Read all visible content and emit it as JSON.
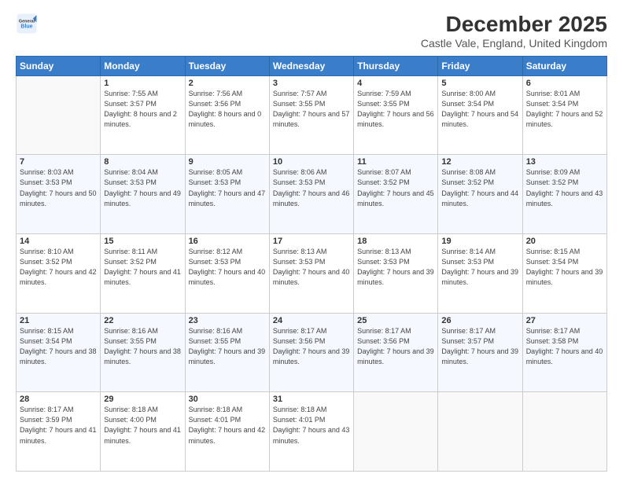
{
  "header": {
    "logo_general": "General",
    "logo_blue": "Blue",
    "title": "December 2025",
    "subtitle": "Castle Vale, England, United Kingdom"
  },
  "days_of_week": [
    "Sunday",
    "Monday",
    "Tuesday",
    "Wednesday",
    "Thursday",
    "Friday",
    "Saturday"
  ],
  "weeks": [
    [
      {
        "day": "",
        "empty": true
      },
      {
        "day": "1",
        "sunrise": "Sunrise: 7:55 AM",
        "sunset": "Sunset: 3:57 PM",
        "daylight": "Daylight: 8 hours and 2 minutes."
      },
      {
        "day": "2",
        "sunrise": "Sunrise: 7:56 AM",
        "sunset": "Sunset: 3:56 PM",
        "daylight": "Daylight: 8 hours and 0 minutes."
      },
      {
        "day": "3",
        "sunrise": "Sunrise: 7:57 AM",
        "sunset": "Sunset: 3:55 PM",
        "daylight": "Daylight: 7 hours and 57 minutes."
      },
      {
        "day": "4",
        "sunrise": "Sunrise: 7:59 AM",
        "sunset": "Sunset: 3:55 PM",
        "daylight": "Daylight: 7 hours and 56 minutes."
      },
      {
        "day": "5",
        "sunrise": "Sunrise: 8:00 AM",
        "sunset": "Sunset: 3:54 PM",
        "daylight": "Daylight: 7 hours and 54 minutes."
      },
      {
        "day": "6",
        "sunrise": "Sunrise: 8:01 AM",
        "sunset": "Sunset: 3:54 PM",
        "daylight": "Daylight: 7 hours and 52 minutes."
      }
    ],
    [
      {
        "day": "7",
        "sunrise": "Sunrise: 8:03 AM",
        "sunset": "Sunset: 3:53 PM",
        "daylight": "Daylight: 7 hours and 50 minutes."
      },
      {
        "day": "8",
        "sunrise": "Sunrise: 8:04 AM",
        "sunset": "Sunset: 3:53 PM",
        "daylight": "Daylight: 7 hours and 49 minutes."
      },
      {
        "day": "9",
        "sunrise": "Sunrise: 8:05 AM",
        "sunset": "Sunset: 3:53 PM",
        "daylight": "Daylight: 7 hours and 47 minutes."
      },
      {
        "day": "10",
        "sunrise": "Sunrise: 8:06 AM",
        "sunset": "Sunset: 3:53 PM",
        "daylight": "Daylight: 7 hours and 46 minutes."
      },
      {
        "day": "11",
        "sunrise": "Sunrise: 8:07 AM",
        "sunset": "Sunset: 3:52 PM",
        "daylight": "Daylight: 7 hours and 45 minutes."
      },
      {
        "day": "12",
        "sunrise": "Sunrise: 8:08 AM",
        "sunset": "Sunset: 3:52 PM",
        "daylight": "Daylight: 7 hours and 44 minutes."
      },
      {
        "day": "13",
        "sunrise": "Sunrise: 8:09 AM",
        "sunset": "Sunset: 3:52 PM",
        "daylight": "Daylight: 7 hours and 43 minutes."
      }
    ],
    [
      {
        "day": "14",
        "sunrise": "Sunrise: 8:10 AM",
        "sunset": "Sunset: 3:52 PM",
        "daylight": "Daylight: 7 hours and 42 minutes."
      },
      {
        "day": "15",
        "sunrise": "Sunrise: 8:11 AM",
        "sunset": "Sunset: 3:52 PM",
        "daylight": "Daylight: 7 hours and 41 minutes."
      },
      {
        "day": "16",
        "sunrise": "Sunrise: 8:12 AM",
        "sunset": "Sunset: 3:53 PM",
        "daylight": "Daylight: 7 hours and 40 minutes."
      },
      {
        "day": "17",
        "sunrise": "Sunrise: 8:13 AM",
        "sunset": "Sunset: 3:53 PM",
        "daylight": "Daylight: 7 hours and 40 minutes."
      },
      {
        "day": "18",
        "sunrise": "Sunrise: 8:13 AM",
        "sunset": "Sunset: 3:53 PM",
        "daylight": "Daylight: 7 hours and 39 minutes."
      },
      {
        "day": "19",
        "sunrise": "Sunrise: 8:14 AM",
        "sunset": "Sunset: 3:53 PM",
        "daylight": "Daylight: 7 hours and 39 minutes."
      },
      {
        "day": "20",
        "sunrise": "Sunrise: 8:15 AM",
        "sunset": "Sunset: 3:54 PM",
        "daylight": "Daylight: 7 hours and 39 minutes."
      }
    ],
    [
      {
        "day": "21",
        "sunrise": "Sunrise: 8:15 AM",
        "sunset": "Sunset: 3:54 PM",
        "daylight": "Daylight: 7 hours and 38 minutes."
      },
      {
        "day": "22",
        "sunrise": "Sunrise: 8:16 AM",
        "sunset": "Sunset: 3:55 PM",
        "daylight": "Daylight: 7 hours and 38 minutes."
      },
      {
        "day": "23",
        "sunrise": "Sunrise: 8:16 AM",
        "sunset": "Sunset: 3:55 PM",
        "daylight": "Daylight: 7 hours and 39 minutes."
      },
      {
        "day": "24",
        "sunrise": "Sunrise: 8:17 AM",
        "sunset": "Sunset: 3:56 PM",
        "daylight": "Daylight: 7 hours and 39 minutes."
      },
      {
        "day": "25",
        "sunrise": "Sunrise: 8:17 AM",
        "sunset": "Sunset: 3:56 PM",
        "daylight": "Daylight: 7 hours and 39 minutes."
      },
      {
        "day": "26",
        "sunrise": "Sunrise: 8:17 AM",
        "sunset": "Sunset: 3:57 PM",
        "daylight": "Daylight: 7 hours and 39 minutes."
      },
      {
        "day": "27",
        "sunrise": "Sunrise: 8:17 AM",
        "sunset": "Sunset: 3:58 PM",
        "daylight": "Daylight: 7 hours and 40 minutes."
      }
    ],
    [
      {
        "day": "28",
        "sunrise": "Sunrise: 8:17 AM",
        "sunset": "Sunset: 3:59 PM",
        "daylight": "Daylight: 7 hours and 41 minutes."
      },
      {
        "day": "29",
        "sunrise": "Sunrise: 8:18 AM",
        "sunset": "Sunset: 4:00 PM",
        "daylight": "Daylight: 7 hours and 41 minutes."
      },
      {
        "day": "30",
        "sunrise": "Sunrise: 8:18 AM",
        "sunset": "Sunset: 4:01 PM",
        "daylight": "Daylight: 7 hours and 42 minutes."
      },
      {
        "day": "31",
        "sunrise": "Sunrise: 8:18 AM",
        "sunset": "Sunset: 4:01 PM",
        "daylight": "Daylight: 7 hours and 43 minutes."
      },
      {
        "day": "",
        "empty": true
      },
      {
        "day": "",
        "empty": true
      },
      {
        "day": "",
        "empty": true
      }
    ]
  ]
}
